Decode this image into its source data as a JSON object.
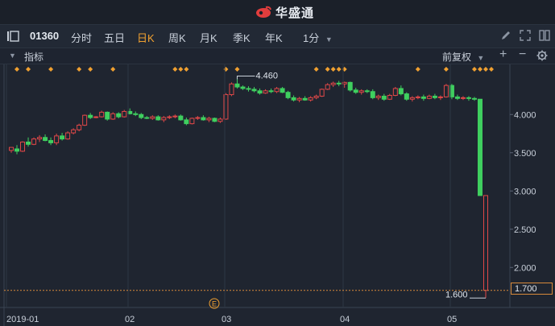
{
  "app": {
    "name": "华盛通",
    "brand_color": "#e23d3d"
  },
  "toolbar": {
    "symbol": "01360",
    "tabs": [
      {
        "label": "分时",
        "active": false
      },
      {
        "label": "五日",
        "active": false
      },
      {
        "label": "日K",
        "active": true
      },
      {
        "label": "周K",
        "active": false
      },
      {
        "label": "月K",
        "active": false
      },
      {
        "label": "季K",
        "active": false
      },
      {
        "label": "年K",
        "active": false
      }
    ],
    "period": "1分",
    "icons": [
      "pencil-icon",
      "fullscreen-icon",
      "split-icon"
    ]
  },
  "indicator_bar": {
    "label": "指标",
    "adjust": "前复权",
    "icons": [
      "plus-icon",
      "minus-icon",
      "gear-icon"
    ]
  },
  "chart_data": {
    "type": "candlestick",
    "x_labels": [
      "2019-01",
      "02",
      "03",
      "04",
      "05"
    ],
    "y_ticks": [
      "4.000",
      "3.500",
      "3.000",
      "2.500",
      "2.000"
    ],
    "ylim": [
      1.55,
      4.55
    ],
    "high_annotation": "4.460",
    "low_annotation": "1.600",
    "last_price": "1.700",
    "last_price_value": 1.7,
    "event_marker": "E",
    "up_color": "#e04848",
    "down_color": "#3fcf5f",
    "marker_color": "#f0a030",
    "candles": [
      [
        3.53,
        3.57,
        3.5,
        3.57
      ],
      [
        3.55,
        3.6,
        3.48,
        3.52
      ],
      [
        3.52,
        3.65,
        3.51,
        3.64
      ],
      [
        3.64,
        3.7,
        3.58,
        3.61
      ],
      [
        3.61,
        3.7,
        3.6,
        3.68
      ],
      [
        3.68,
        3.73,
        3.64,
        3.7
      ],
      [
        3.7,
        3.74,
        3.65,
        3.66
      ],
      [
        3.66,
        3.7,
        3.6,
        3.63
      ],
      [
        3.63,
        3.75,
        3.6,
        3.72
      ],
      [
        3.72,
        3.76,
        3.66,
        3.68
      ],
      [
        3.68,
        3.78,
        3.67,
        3.76
      ],
      [
        3.76,
        3.82,
        3.74,
        3.8
      ],
      [
        3.8,
        3.88,
        3.78,
        3.86
      ],
      [
        3.86,
        4.0,
        3.85,
        3.99
      ],
      [
        3.99,
        4.02,
        3.94,
        3.96
      ],
      [
        3.96,
        3.98,
        3.95,
        3.97
      ],
      [
        3.97,
        4.05,
        3.96,
        4.03
      ],
      [
        4.03,
        4.04,
        3.92,
        3.94
      ],
      [
        3.94,
        4.03,
        3.93,
        4.01
      ],
      [
        4.01,
        4.03,
        3.95,
        3.97
      ],
      [
        3.97,
        4.06,
        3.96,
        4.04
      ],
      [
        4.04,
        4.08,
        4.0,
        4.01
      ],
      [
        4.01,
        4.04,
        3.98,
        4.0
      ],
      [
        4.0,
        4.02,
        3.94,
        3.96
      ],
      [
        3.96,
        3.98,
        3.94,
        3.95
      ],
      [
        3.95,
        3.99,
        3.93,
        3.97
      ],
      [
        3.97,
        3.99,
        3.92,
        3.93
      ],
      [
        3.93,
        3.98,
        3.9,
        3.96
      ],
      [
        3.96,
        3.99,
        3.94,
        3.97
      ],
      [
        3.97,
        4.0,
        3.95,
        3.98
      ],
      [
        3.98,
        4.0,
        3.92,
        3.93
      ],
      [
        3.93,
        3.96,
        3.86,
        3.88
      ],
      [
        3.88,
        3.96,
        3.87,
        3.95
      ],
      [
        3.95,
        3.98,
        3.93,
        3.96
      ],
      [
        3.96,
        3.99,
        3.92,
        3.93
      ],
      [
        3.93,
        3.97,
        3.9,
        3.95
      ],
      [
        3.95,
        3.96,
        3.9,
        3.91
      ],
      [
        3.91,
        3.96,
        3.89,
        3.94
      ],
      [
        3.94,
        4.28,
        3.93,
        4.26
      ],
      [
        4.26,
        4.42,
        4.24,
        4.4
      ],
      [
        4.4,
        4.46,
        4.34,
        4.36
      ],
      [
        4.36,
        4.38,
        4.32,
        4.34
      ],
      [
        4.34,
        4.37,
        4.3,
        4.33
      ],
      [
        4.33,
        4.36,
        4.29,
        4.31
      ],
      [
        4.31,
        4.34,
        4.26,
        4.28
      ],
      [
        4.28,
        4.33,
        4.27,
        4.31
      ],
      [
        4.31,
        4.34,
        4.28,
        4.3
      ],
      [
        4.3,
        4.36,
        4.28,
        4.34
      ],
      [
        4.34,
        4.36,
        4.28,
        4.29
      ],
      [
        4.29,
        4.31,
        4.2,
        4.22
      ],
      [
        4.22,
        4.25,
        4.17,
        4.19
      ],
      [
        4.19,
        4.23,
        4.16,
        4.21
      ],
      [
        4.21,
        4.24,
        4.18,
        4.19
      ],
      [
        4.19,
        4.24,
        4.17,
        4.22
      ],
      [
        4.22,
        4.26,
        4.2,
        4.24
      ],
      [
        4.24,
        4.34,
        4.23,
        4.33
      ],
      [
        4.33,
        4.41,
        4.32,
        4.39
      ],
      [
        4.39,
        4.43,
        4.36,
        4.41
      ],
      [
        4.41,
        4.44,
        4.37,
        4.4
      ],
      [
        4.4,
        4.43,
        4.35,
        4.42
      ],
      [
        4.42,
        4.43,
        4.3,
        4.32
      ],
      [
        4.32,
        4.35,
        4.27,
        4.29
      ],
      [
        4.29,
        4.33,
        4.26,
        4.31
      ],
      [
        4.31,
        4.33,
        4.28,
        4.3
      ],
      [
        4.3,
        4.33,
        4.2,
        4.22
      ],
      [
        4.22,
        4.26,
        4.19,
        4.24
      ],
      [
        4.24,
        4.27,
        4.18,
        4.2
      ],
      [
        4.2,
        4.27,
        4.19,
        4.25
      ],
      [
        4.25,
        4.36,
        4.24,
        4.34
      ],
      [
        4.34,
        4.38,
        4.25,
        4.27
      ],
      [
        4.27,
        4.29,
        4.18,
        4.2
      ],
      [
        4.2,
        4.24,
        4.17,
        4.22
      ],
      [
        4.22,
        4.25,
        4.2,
        4.23
      ],
      [
        4.23,
        4.26,
        4.18,
        4.21
      ],
      [
        4.21,
        4.26,
        4.2,
        4.24
      ],
      [
        4.24,
        4.27,
        4.2,
        4.22
      ],
      [
        4.22,
        4.25,
        4.19,
        4.23
      ],
      [
        4.23,
        4.4,
        4.22,
        4.38
      ],
      [
        4.38,
        4.4,
        4.2,
        4.23
      ],
      [
        4.23,
        4.26,
        4.19,
        4.21
      ],
      [
        4.21,
        4.24,
        4.19,
        4.22
      ],
      [
        4.22,
        4.24,
        4.18,
        4.21
      ],
      [
        4.21,
        4.23,
        4.18,
        4.2
      ],
      [
        4.2,
        4.2,
        2.94,
        2.94
      ],
      [
        1.7,
        2.94,
        1.6,
        2.94
      ]
    ],
    "markers_at": [
      1,
      3,
      7,
      12,
      14,
      18,
      29,
      30,
      31,
      38,
      40,
      54,
      56,
      57,
      58,
      59,
      72,
      77,
      82,
      83,
      84,
      85
    ]
  }
}
